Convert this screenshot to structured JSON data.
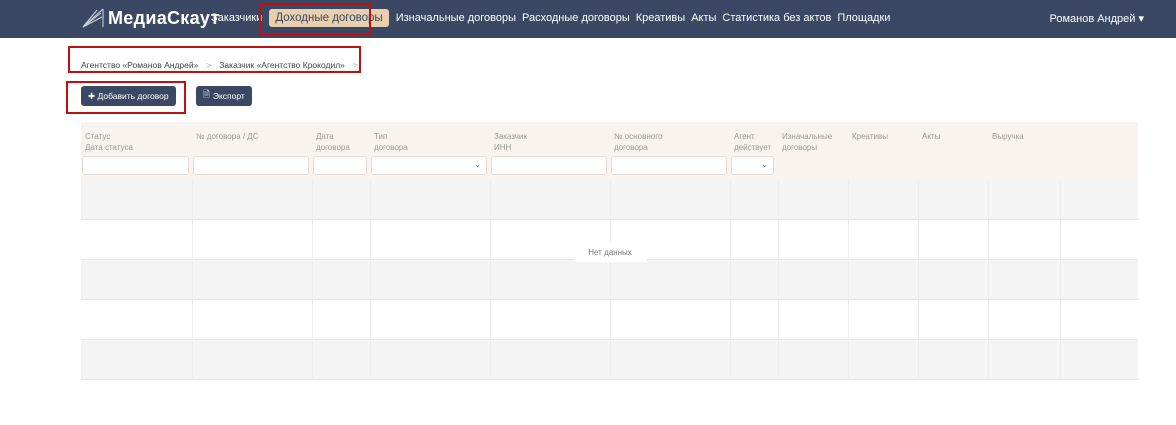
{
  "nav": {
    "logo": "МедиаСкаут",
    "items": [
      "Заказчики",
      "Доходные договоры",
      "Изначальные договоры",
      "Расходные договоры",
      "Креативы",
      "Акты",
      "Статистика без актов",
      "Площадки"
    ],
    "active_index": 1,
    "user": "Романов Андрей ▾"
  },
  "breadcrumb": [
    "Агентство «Романов Андрей»",
    "Заказчик «Агентство Крокодил»"
  ],
  "breadcrumb_sep": ">",
  "toolbar": {
    "add": "✚ Добавить договор",
    "export": "Экспорт"
  },
  "table": {
    "columns": [
      [
        "Статус",
        "Дата статуса"
      ],
      [
        "№ договора / ДС",
        ""
      ],
      [
        "Дата",
        "договора"
      ],
      [
        "Тип",
        "договора"
      ],
      [
        "Заказчик",
        "ИНН"
      ],
      [
        "№ основного",
        "договора"
      ],
      [
        "Агент",
        "действует"
      ],
      [
        "Изначальные",
        "договоры"
      ],
      [
        "Креативы",
        ""
      ],
      [
        "Акты",
        ""
      ],
      [
        "Выручка",
        ""
      ]
    ],
    "empty": "Нет данных"
  },
  "colors": {
    "nav": "#3b4863",
    "active": "#e8cfae",
    "highlight": "#c01010"
  }
}
